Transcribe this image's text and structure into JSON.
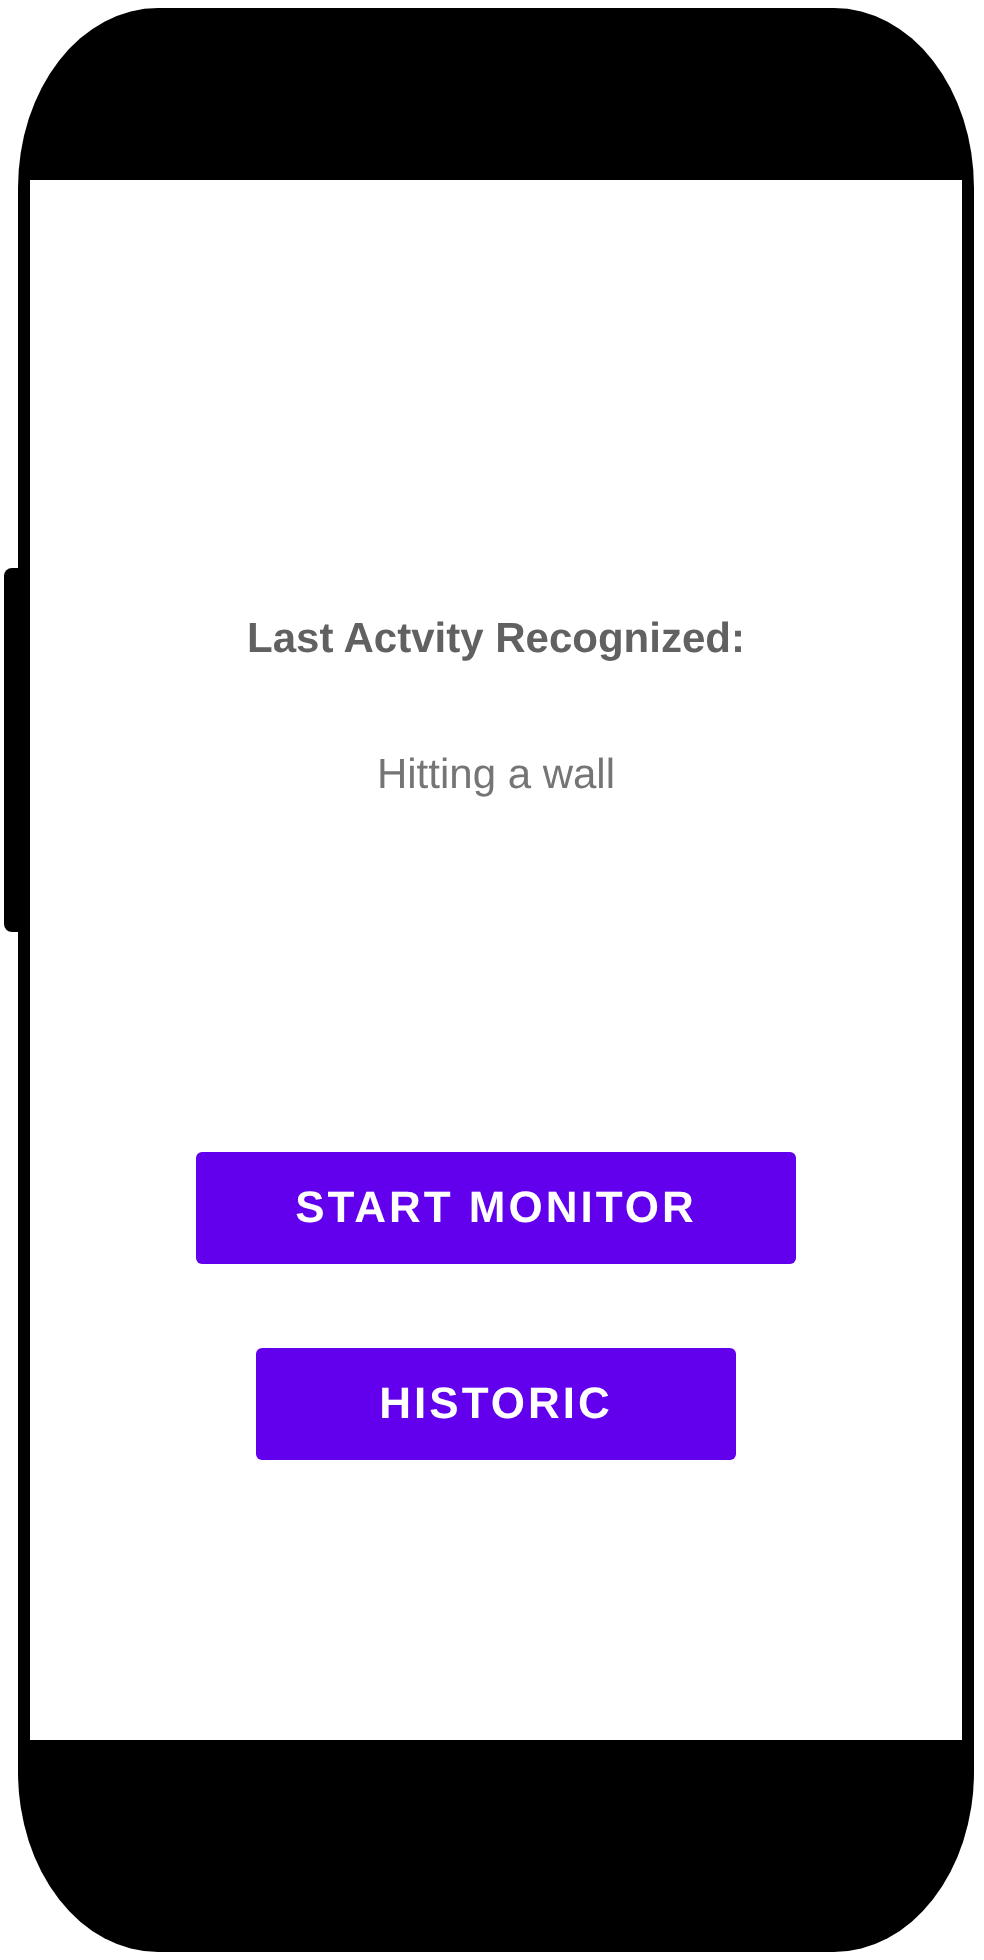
{
  "screen": {
    "heading": "Last Actvity Recognized:",
    "activity": "Hitting a wall"
  },
  "buttons": [
    {
      "label": "START MONITOR",
      "kind": "wide"
    },
    {
      "label": "HISTORIC",
      "kind": "narrow"
    }
  ]
}
